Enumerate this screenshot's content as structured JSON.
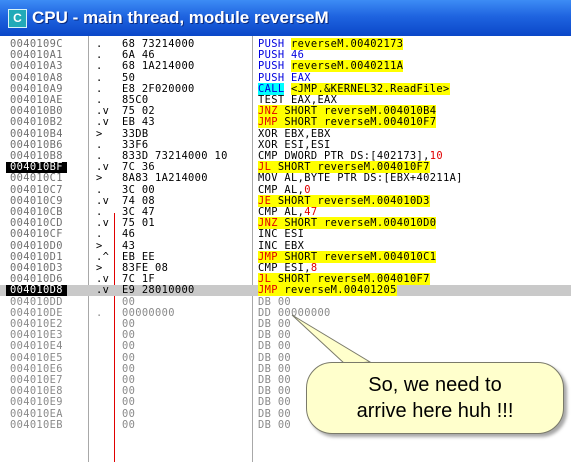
{
  "window": {
    "title": "CPU - main thread, module reverseM",
    "icon_letter": "C"
  },
  "rows": [
    {
      "addr": "0040109C",
      "mark": ".",
      "hex": "68 73214000",
      "dis": [
        [
          "PUSH ",
          "push"
        ],
        [
          "reverseM.00402173",
          "yel"
        ]
      ]
    },
    {
      "addr": "004010A1",
      "mark": ".",
      "hex": "6A 46",
      "dis": [
        [
          "PUSH 46",
          "push"
        ]
      ]
    },
    {
      "addr": "004010A3",
      "mark": ".",
      "hex": "68 1A214000",
      "dis": [
        [
          "PUSH ",
          "push"
        ],
        [
          "reverseM.0040211A",
          "yel"
        ]
      ]
    },
    {
      "addr": "004010A8",
      "mark": ".",
      "hex": "50",
      "dis": [
        [
          "PUSH EAX",
          "push"
        ]
      ]
    },
    {
      "addr": "004010A9",
      "mark": ".",
      "hex": "E8 2F020000",
      "dis": [
        [
          "CALL",
          "cyan"
        ],
        [
          " ",
          ""
        ],
        [
          "<JMP.&KERNEL32.ReadFile>",
          "yel"
        ]
      ]
    },
    {
      "addr": "004010AE",
      "mark": ".",
      "hex": "85C0",
      "dis": [
        [
          "TEST EAX,EAX",
          ""
        ]
      ]
    },
    {
      "addr": "004010B0",
      "mark": ".v",
      "hex": "75 02",
      "dis": [
        [
          "JNZ",
          "red"
        ],
        [
          " SHORT reverseM.004010B4",
          "yel"
        ]
      ]
    },
    {
      "addr": "004010B2",
      "mark": ".v",
      "hex": "EB 43",
      "dis": [
        [
          "JMP",
          "red"
        ],
        [
          " SHORT reverseM.004010F7",
          "yel"
        ]
      ]
    },
    {
      "addr": "004010B4",
      "mark": ">",
      "hex": "33DB",
      "dis": [
        [
          "XOR EBX,EBX",
          ""
        ]
      ]
    },
    {
      "addr": "004010B6",
      "mark": ".",
      "hex": "33F6",
      "dis": [
        [
          "XOR ESI,ESI",
          ""
        ]
      ]
    },
    {
      "addr": "004010B8",
      "mark": ".",
      "hex": "833D 73214000 10",
      "dis": [
        [
          "CMP DWORD PTR DS:[402173],",
          ""
        ],
        [
          "10",
          "num"
        ]
      ]
    },
    {
      "addr": "004010BF",
      "mark": ".v",
      "hex": "7C 36",
      "dis": [
        [
          "JL",
          "red"
        ],
        [
          " SHORT reverseM.004010F7",
          "yel"
        ]
      ],
      "hl": true
    },
    {
      "addr": "004010C1",
      "mark": ">",
      "hex": "8A83 1A214000",
      "dis": [
        [
          "MOV AL,BYTE PTR DS:[EBX+40211A]",
          ""
        ]
      ]
    },
    {
      "addr": "004010C7",
      "mark": ".",
      "hex": "3C 00",
      "dis": [
        [
          "CMP AL,",
          ""
        ],
        [
          "0",
          "num"
        ]
      ]
    },
    {
      "addr": "004010C9",
      "mark": ".v",
      "hex": "74 08",
      "dis": [
        [
          "JE",
          "red"
        ],
        [
          " SHORT reverseM.004010D3",
          "yel"
        ]
      ]
    },
    {
      "addr": "004010CB",
      "mark": ".",
      "hex": "3C 47",
      "dis": [
        [
          "CMP AL,",
          ""
        ],
        [
          "47",
          "num"
        ]
      ]
    },
    {
      "addr": "004010CD",
      "mark": ".v",
      "hex": "75 01",
      "dis": [
        [
          "JNZ",
          "red"
        ],
        [
          " SHORT reverseM.004010D0",
          "yel"
        ]
      ]
    },
    {
      "addr": "004010CF",
      "mark": ".",
      "hex": "46",
      "dis": [
        [
          "INC ESI",
          ""
        ]
      ]
    },
    {
      "addr": "004010D0",
      "mark": ">",
      "hex": "43",
      "dis": [
        [
          "INC EBX",
          ""
        ]
      ]
    },
    {
      "addr": "004010D1",
      "mark": ".^",
      "hex": "EB EE",
      "dis": [
        [
          "JMP",
          "red"
        ],
        [
          " SHORT reverseM.004010C1",
          "yel"
        ]
      ]
    },
    {
      "addr": "004010D3",
      "mark": ">",
      "hex": "83FE 08",
      "dis": [
        [
          "CMP ESI,",
          ""
        ],
        [
          "8",
          "num"
        ]
      ]
    },
    {
      "addr": "004010D6",
      "mark": ".v",
      "hex": "7C 1F",
      "dis": [
        [
          "JL",
          "red"
        ],
        [
          " SHORT reverseM.004010F7",
          "yel"
        ]
      ]
    },
    {
      "addr": "004010D8",
      "mark": ".v",
      "hex": "E9 28010000",
      "dis": [
        [
          "JMP",
          "red"
        ],
        [
          " reverseM.00401205",
          "yel"
        ]
      ],
      "sel": true
    },
    {
      "addr": "004010DD",
      "mark": "",
      "hex": "00",
      "dis": [
        [
          "DB 00",
          ""
        ]
      ],
      "faded": true
    },
    {
      "addr": "004010DE",
      "mark": ".",
      "hex": "00000000",
      "dis": [
        [
          "DD 00000000",
          ""
        ]
      ],
      "faded": true
    },
    {
      "addr": "004010E2",
      "mark": "",
      "hex": "00",
      "dis": [
        [
          "DB 00",
          ""
        ]
      ],
      "faded": true
    },
    {
      "addr": "004010E3",
      "mark": "",
      "hex": "00",
      "dis": [
        [
          "DB 00",
          ""
        ]
      ],
      "faded": true
    },
    {
      "addr": "004010E4",
      "mark": "",
      "hex": "00",
      "dis": [
        [
          "DB 00",
          ""
        ]
      ],
      "faded": true
    },
    {
      "addr": "004010E5",
      "mark": "",
      "hex": "00",
      "dis": [
        [
          "DB 00",
          ""
        ]
      ],
      "faded": true
    },
    {
      "addr": "004010E6",
      "mark": "",
      "hex": "00",
      "dis": [
        [
          "DB 00",
          ""
        ]
      ],
      "faded": true
    },
    {
      "addr": "004010E7",
      "mark": "",
      "hex": "00",
      "dis": [
        [
          "DB 00",
          ""
        ]
      ],
      "faded": true
    },
    {
      "addr": "004010E8",
      "mark": "",
      "hex": "00",
      "dis": [
        [
          "DB 00",
          ""
        ]
      ],
      "faded": true
    },
    {
      "addr": "004010E9",
      "mark": "",
      "hex": "00",
      "dis": [
        [
          "DB 00",
          ""
        ]
      ],
      "faded": true
    },
    {
      "addr": "004010EA",
      "mark": "",
      "hex": "00",
      "dis": [
        [
          "DB 00",
          ""
        ]
      ],
      "faded": true
    },
    {
      "addr": "004010EB",
      "mark": "",
      "hex": "00",
      "dis": [
        [
          "DB 00",
          ""
        ]
      ],
      "faded": true
    }
  ],
  "callout": {
    "text": "So, we need to\narrive here huh !!!"
  },
  "colors": {
    "title_bar": "#1f64e0",
    "jump_highlight": "#ffff00",
    "call_highlight": "#00ffff",
    "jump_text": "#e00000",
    "push_text": "#0000e0",
    "callout_fill": "#ffffcc"
  }
}
